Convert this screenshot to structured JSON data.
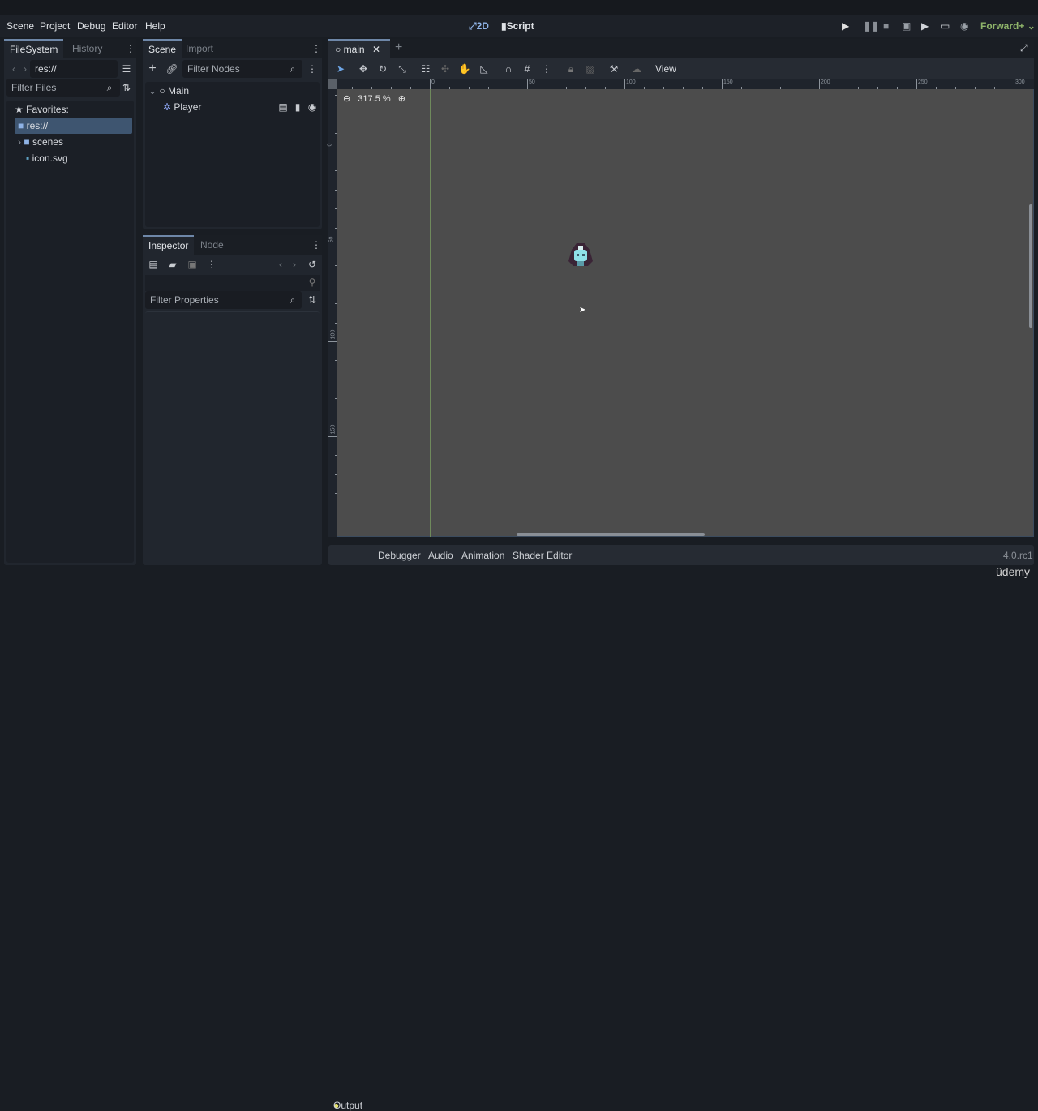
{
  "menu": [
    "Scene",
    "Project",
    "Debug",
    "Editor",
    "Help"
  ],
  "workspaces": {
    "twod": "2D",
    "script": "Script"
  },
  "renderer": "Forward+",
  "filesystem": {
    "tabs": [
      "FileSystem",
      "History"
    ],
    "path": "res://",
    "filter_placeholder": "Filter Files",
    "favorites": "Favorites:",
    "items": [
      "res://",
      "scenes",
      "icon.svg"
    ]
  },
  "scene": {
    "tabs": [
      "Scene",
      "Import"
    ],
    "filter_placeholder": "Filter Nodes",
    "nodes": [
      "Main",
      "Player"
    ]
  },
  "inspector": {
    "tabs": [
      "Inspector",
      "Node"
    ],
    "filter_placeholder": "Filter Properties"
  },
  "editor": {
    "tab": "main",
    "zoom": "317.5 %",
    "view": "View",
    "hruler": [
      "0",
      "50",
      "100",
      "150",
      "200",
      "250",
      "300"
    ],
    "vruler": [
      "0",
      "50",
      "100",
      "150"
    ]
  },
  "bottom": {
    "tabs": [
      "Output",
      "Debugger",
      "Audio",
      "Animation",
      "Shader Editor"
    ],
    "version": "4.0.rc1",
    "watermark": "ûdemy"
  },
  "colors": {
    "accent": "#6e87a8",
    "renderer": "#8fb46a",
    "canvas": "#4c4c4c",
    "output_dot": "#e6e36a"
  }
}
